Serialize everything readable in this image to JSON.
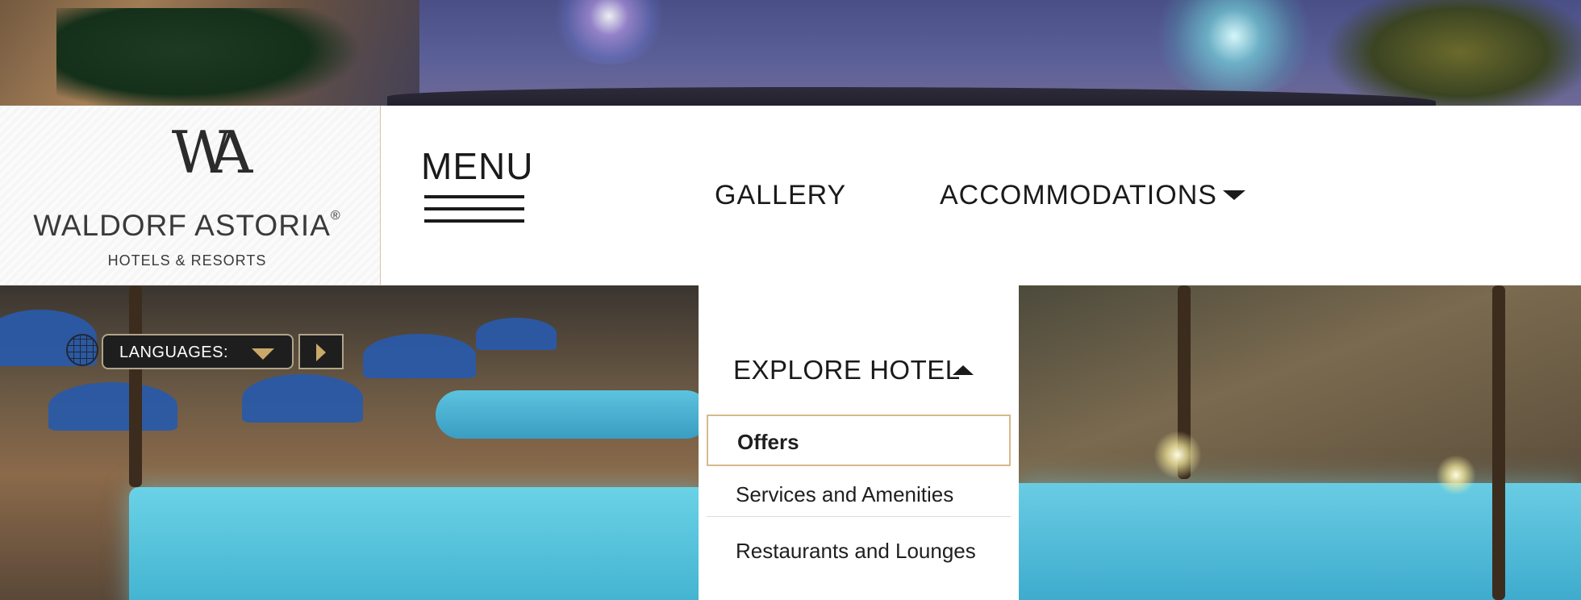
{
  "brand": {
    "mark": "WA",
    "name": "WALDORF ASTORIA",
    "registered": "®",
    "subtitle": "HOTELS & RESORTS"
  },
  "header": {
    "menu_label": "MENU",
    "nav": [
      {
        "label": "GALLERY"
      },
      {
        "label": "ACCOMMODATIONS"
      }
    ]
  },
  "languages": {
    "label": "LANGUAGES:"
  },
  "dropdown": {
    "title": "EXPLORE HOTEL",
    "items": [
      {
        "label": "Offers",
        "selected": true
      },
      {
        "label": "Services and Amenities",
        "selected": false
      },
      {
        "label": "Restaurants and Lounges",
        "selected": false
      }
    ]
  },
  "colors": {
    "accent_gold": "#d7b88b",
    "text_dark": "#1a1a1a",
    "header_bg": "#ffffff"
  },
  "icons": [
    "menu-hamburger-icon",
    "chevron-down-icon",
    "chevron-up-icon",
    "globe-icon",
    "play-arrow-icon"
  ]
}
